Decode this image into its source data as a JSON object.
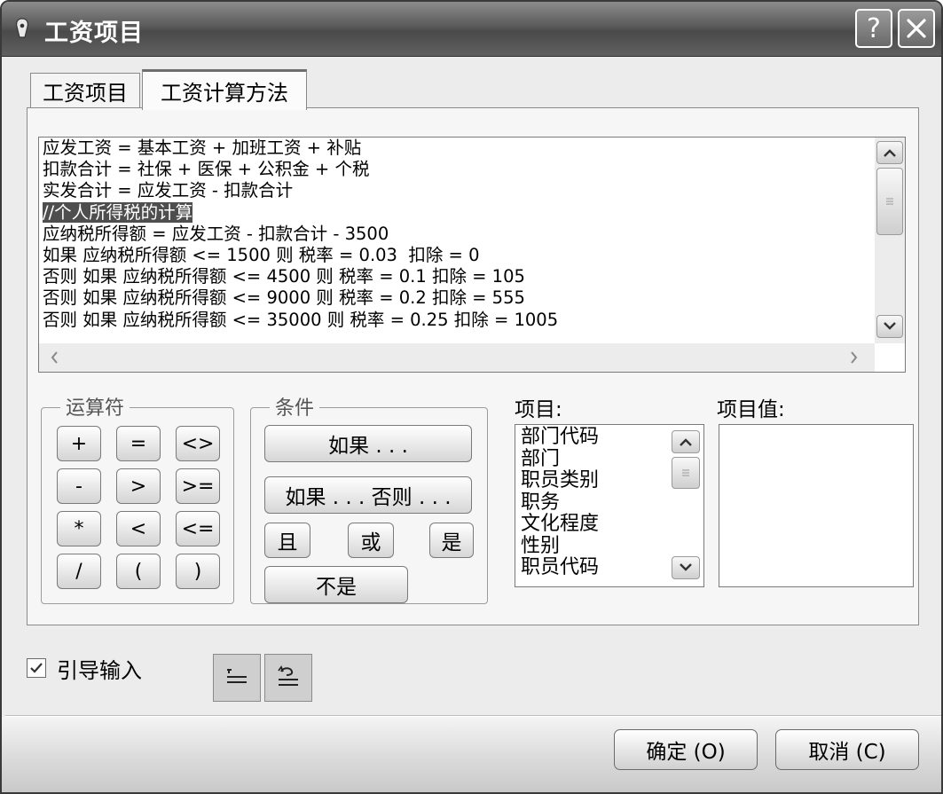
{
  "window": {
    "title": "工资项目",
    "help_label": "?",
    "close_label": "✕"
  },
  "tabs": [
    {
      "label": "工资项目",
      "active": false
    },
    {
      "label": "工资计算方法",
      "active": true
    }
  ],
  "formula": {
    "lines": [
      "应发工资 = 基本工资 + 加班工资 + 补贴",
      "扣款合计 = 社保 + 医保 + 公积金 + 个税",
      "实发合计 = 应发工资 - 扣款合计",
      "//个人所得税的计算",
      "应纳税所得额 = 应发工资 - 扣款合计 - 3500",
      "如果 应纳税所得额 <= 1500 则 税率 = 0.03  扣除 = 0",
      "否则 如果 应纳税所得额 <= 4500 则 税率 = 0.1 扣除 = 105",
      "否则 如果 应纳税所得额 <= 9000 则 税率 = 0.2 扣除 = 555",
      "否则 如果 应纳税所得额 <= 35000 则 税率 = 0.25 扣除 = 1005"
    ],
    "selected_line": 3
  },
  "operators": {
    "legend": "运算符",
    "buttons": [
      "+",
      "=",
      "<>",
      "-",
      ">",
      ">=",
      "*",
      "<",
      "<=",
      "/",
      "(",
      ")"
    ]
  },
  "conditions": {
    "legend": "条件",
    "if": "如果 . . .",
    "if_else": "如果 . . .  否则 . . .",
    "and": "且",
    "or": "或",
    "is": "是",
    "not": "不是"
  },
  "items": {
    "label": "项目:",
    "list": [
      "部门代码",
      "部门",
      "职员类别",
      "职务",
      "文化程度",
      "性别",
      "职员代码"
    ]
  },
  "item_values": {
    "label": "项目值:"
  },
  "guide": {
    "label": "引导输入",
    "checked": true
  },
  "footer": {
    "ok_label": "确定 (O)",
    "cancel_label": "取消 (C)"
  },
  "colors": {
    "titlebar": "#5a5a5a",
    "selection": "#4e4e4e",
    "window_bg": "#ececec"
  }
}
